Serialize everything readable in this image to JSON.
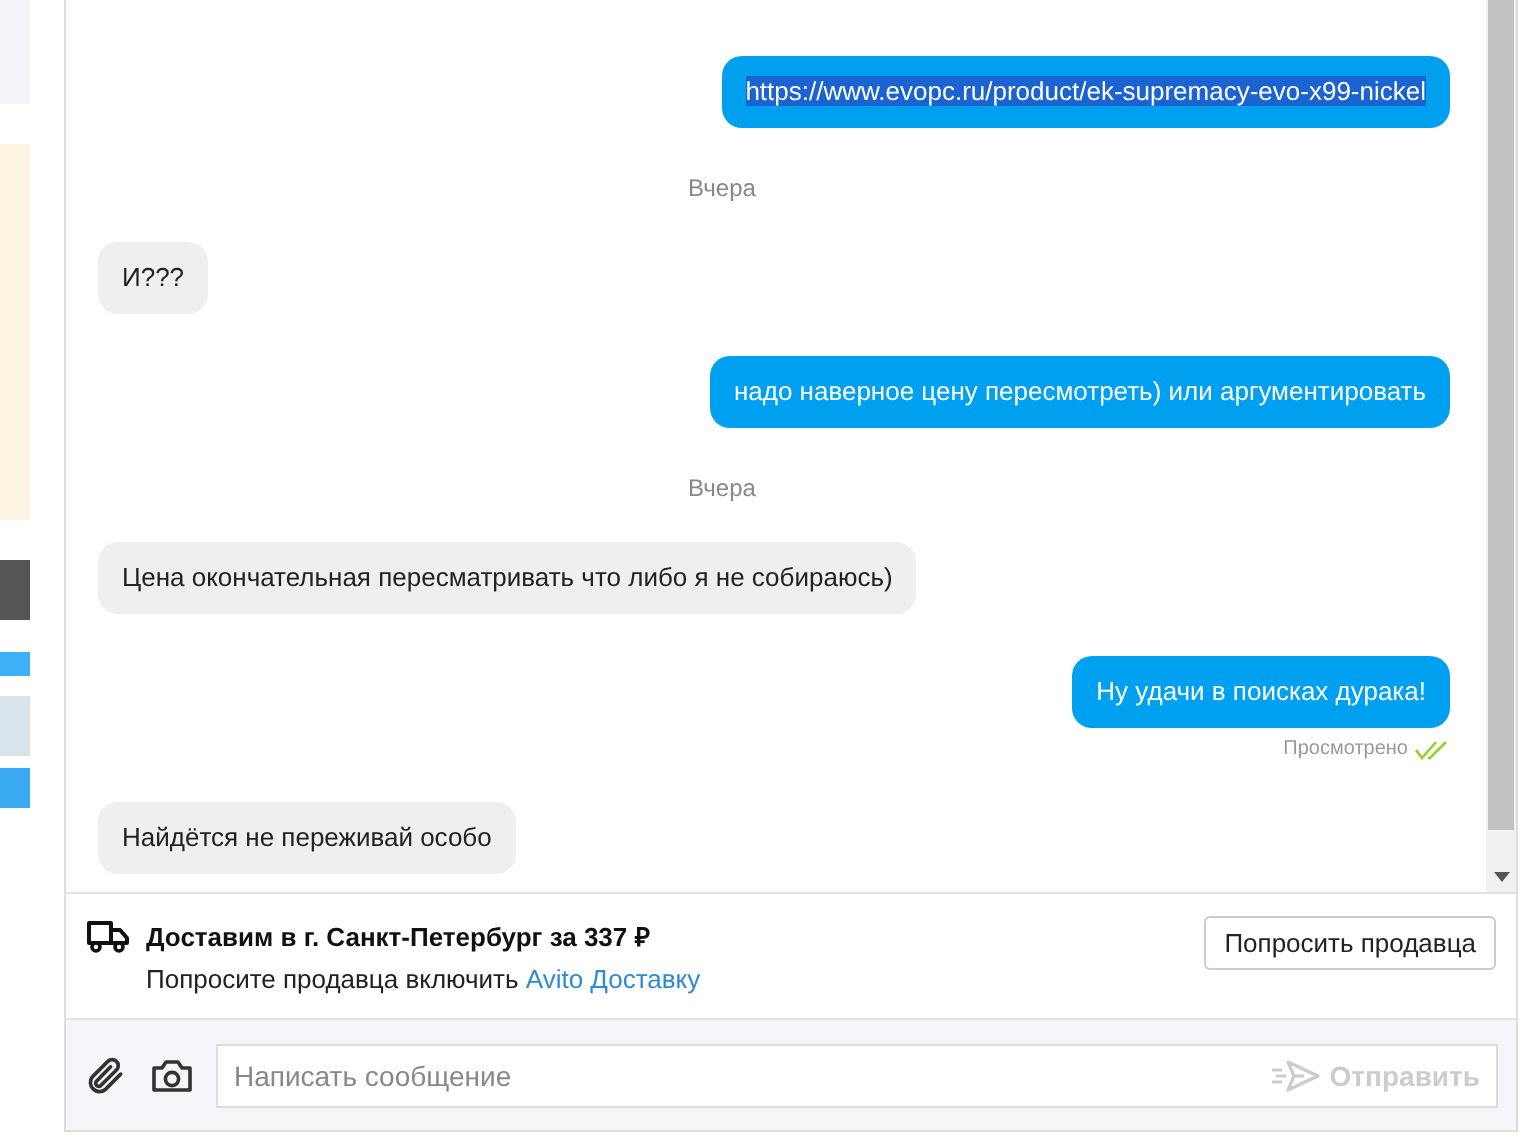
{
  "messages": [
    {
      "kind": "out",
      "text": "https://www.evopc.ru/product/ek-supremacy-evo-x99-nickel",
      "text_selected": true
    },
    {
      "kind": "date",
      "text": "Вчера"
    },
    {
      "kind": "in",
      "text": "И???"
    },
    {
      "kind": "out",
      "text": "надо наверное цену пересмотреть) или аргументировать",
      "text_selected": false
    },
    {
      "kind": "date",
      "text": "Вчера"
    },
    {
      "kind": "in",
      "text": "Цена окончательная пересматривать что либо я не собираюсь)"
    },
    {
      "kind": "out",
      "text": "Ну удачи в поисках дурака!",
      "text_selected": false,
      "status": "Просмотрено"
    },
    {
      "kind": "in",
      "text": "Найдётся не переживай особо"
    }
  ],
  "delivery": {
    "title": "Доставим в г. Санкт-Петербург за 337 ₽",
    "hint": "Попросите продавца включить",
    "link": "Avito Доставку",
    "button": "Попросить продавца"
  },
  "composer": {
    "placeholder": "Написать сообщение",
    "send": "Отправить"
  }
}
